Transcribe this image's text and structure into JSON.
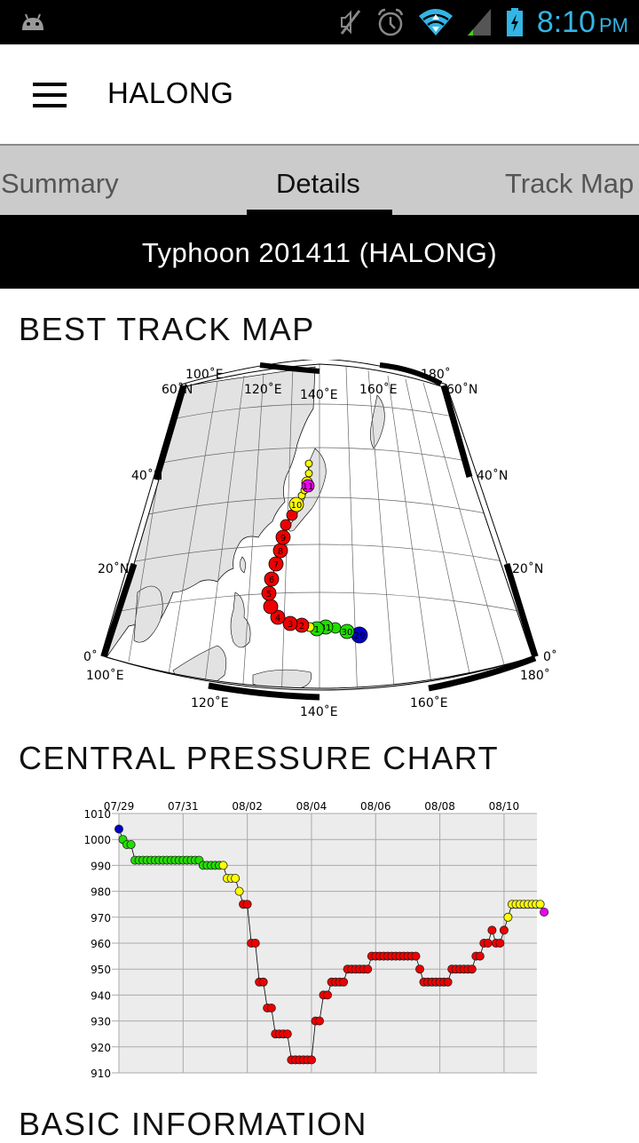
{
  "status_bar": {
    "time": "8:10",
    "ampm": "PM",
    "icons": [
      "android-debug-icon",
      "mute-icon",
      "alarm-icon",
      "wifi-icon",
      "signal-icon",
      "battery-charging-icon"
    ],
    "accent": "#33b5e5"
  },
  "app_bar": {
    "title": "HALONG",
    "menu_icon": "hamburger-icon"
  },
  "tabs": [
    {
      "label": "Summary",
      "active": false
    },
    {
      "label": "Details",
      "active": true
    },
    {
      "label": "Track Map",
      "active": false
    }
  ],
  "banner": {
    "title": "Typhoon 201411 (HALONG)"
  },
  "sections": {
    "best_track_map": "BEST TRACK MAP",
    "central_pressure_chart": "CENTRAL PRESSURE CHART",
    "basic_information": "BASIC INFORMATION"
  },
  "map": {
    "lon_labels": [
      "100˚E",
      "120˚E",
      "140˚E",
      "160˚E",
      "180˚"
    ],
    "lat_labels": [
      "0˚",
      "20˚N",
      "40˚N",
      "60˚N"
    ],
    "track_labels": [
      "29",
      "30",
      "31",
      "1",
      "2",
      "3",
      "4",
      "5",
      "6",
      "7",
      "8",
      "9",
      "10",
      "11"
    ],
    "colors": {
      "td": "#0000cc",
      "ts": "#22dd00",
      "sts": "#ffff00",
      "ty": "#ee0000",
      "extra": "#ee00ee",
      "land": "#e0e0e0"
    }
  },
  "chart_data": {
    "type": "scatter",
    "title": "CENTRAL PRESSURE CHART",
    "xlabel": "",
    "ylabel": "",
    "x_ticks": [
      "07/29",
      "07/31",
      "08/02",
      "08/04",
      "08/06",
      "08/08",
      "08/10"
    ],
    "x_interval_hours": 3,
    "start": "07/29 00",
    "ylim": [
      910,
      1010
    ],
    "y_ticks": [
      910,
      920,
      930,
      940,
      950,
      960,
      970,
      980,
      990,
      1000,
      1010
    ],
    "grid": true,
    "legend": "none",
    "category_colors": {
      "TD": "#0000cc",
      "TS": "#22dd00",
      "STS": "#ffff00",
      "TY": "#ee0000",
      "L": "#ee00ee"
    },
    "segments": [
      {
        "p": 1004,
        "n": 1,
        "c": "TD"
      },
      {
        "p": 1000,
        "n": 1,
        "c": "TS"
      },
      {
        "p": 998,
        "n": 2,
        "c": "TS"
      },
      {
        "p": 992,
        "n": 17,
        "c": "TS"
      },
      {
        "p": 990,
        "n": 5,
        "c": "TS"
      },
      {
        "p": 990,
        "n": 1,
        "c": "STS"
      },
      {
        "p": 985,
        "n": 3,
        "c": "STS"
      },
      {
        "p": 980,
        "n": 1,
        "c": "STS"
      },
      {
        "p": 975,
        "n": 2,
        "c": "TY"
      },
      {
        "p": 960,
        "n": 2,
        "c": "TY"
      },
      {
        "p": 945,
        "n": 2,
        "c": "TY"
      },
      {
        "p": 935,
        "n": 2,
        "c": "TY"
      },
      {
        "p": 925,
        "n": 4,
        "c": "TY"
      },
      {
        "p": 915,
        "n": 6,
        "c": "TY"
      },
      {
        "p": 930,
        "n": 2,
        "c": "TY"
      },
      {
        "p": 940,
        "n": 2,
        "c": "TY"
      },
      {
        "p": 945,
        "n": 4,
        "c": "TY"
      },
      {
        "p": 950,
        "n": 6,
        "c": "TY"
      },
      {
        "p": 955,
        "n": 12,
        "c": "TY"
      },
      {
        "p": 950,
        "n": 1,
        "c": "TY"
      },
      {
        "p": 945,
        "n": 7,
        "c": "TY"
      },
      {
        "p": 950,
        "n": 6,
        "c": "TY"
      },
      {
        "p": 955,
        "n": 2,
        "c": "TY"
      },
      {
        "p": 960,
        "n": 2,
        "c": "TY"
      },
      {
        "p": 965,
        "n": 1,
        "c": "TY"
      },
      {
        "p": 960,
        "n": 2,
        "c": "TY"
      },
      {
        "p": 965,
        "n": 1,
        "c": "TY"
      },
      {
        "p": 970,
        "n": 1,
        "c": "STS"
      },
      {
        "p": 975,
        "n": 8,
        "c": "STS"
      },
      {
        "p": 972,
        "n": 1,
        "c": "L"
      }
    ]
  }
}
